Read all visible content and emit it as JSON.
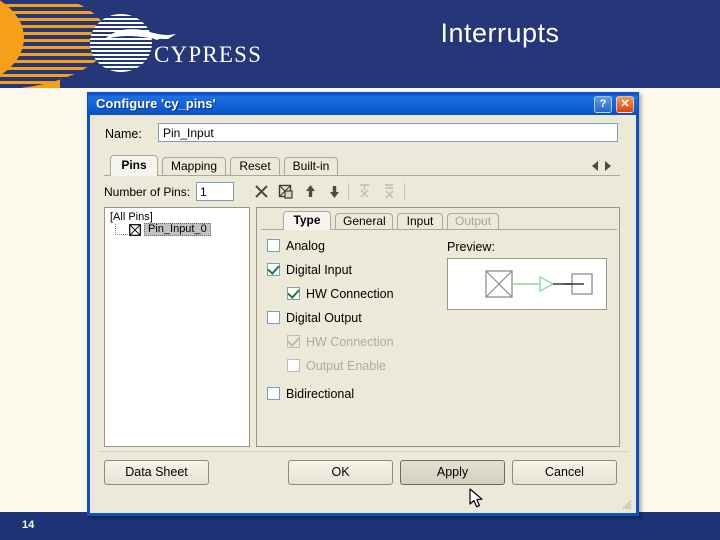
{
  "slide": {
    "title": "Interrupts",
    "number": "14",
    "brand": "CYPRESS",
    "colors": {
      "header_blue": "#253778",
      "accent_orange": "#f6a01a",
      "slide_bg": "#fdf8ec",
      "footer_blue": "#1d3476"
    }
  },
  "dialog": {
    "title": "Configure 'cy_pins'",
    "help_button": "?",
    "close_button": "✕",
    "name_label": "Name:",
    "name_value": "Pin_Input",
    "tabs": [
      {
        "label": "Pins",
        "active": true
      },
      {
        "label": "Mapping",
        "active": false
      },
      {
        "label": "Reset",
        "active": false
      },
      {
        "label": "Built-in",
        "active": false
      }
    ],
    "tab_nav": {
      "prev": "◀",
      "next": "▶"
    },
    "toolbar": {
      "pins_label": "Number of Pins:",
      "pins_value": "1",
      "icons": [
        {
          "name": "delete-pin-icon",
          "enabled": true
        },
        {
          "name": "edit-pin-icon",
          "enabled": true
        },
        {
          "name": "move-up-icon",
          "enabled": true
        },
        {
          "name": "move-down-icon",
          "enabled": true
        },
        {
          "name": "split-pin-icon",
          "enabled": false
        },
        {
          "name": "join-pin-icon",
          "enabled": false
        }
      ]
    },
    "tree": {
      "root": "[All Pins]",
      "items": [
        {
          "label": "Pin_Input_0",
          "selected": true
        }
      ]
    },
    "inner_tabs": [
      {
        "label": "Type",
        "active": true,
        "disabled": false
      },
      {
        "label": "General",
        "active": false,
        "disabled": false
      },
      {
        "label": "Input",
        "active": false,
        "disabled": false
      },
      {
        "label": "Output",
        "active": false,
        "disabled": true
      }
    ],
    "type_options": [
      {
        "label": "Analog",
        "checked": false,
        "disabled": false,
        "indent": 0
      },
      {
        "label": "Digital Input",
        "checked": true,
        "disabled": false,
        "indent": 0
      },
      {
        "label": "HW Connection",
        "checked": true,
        "disabled": false,
        "indent": 1
      },
      {
        "label": "Digital Output",
        "checked": false,
        "disabled": false,
        "indent": 0
      },
      {
        "label": "HW Connection",
        "checked": true,
        "disabled": true,
        "indent": 1
      },
      {
        "label": "Output Enable",
        "checked": false,
        "disabled": true,
        "indent": 1
      },
      {
        "label": "Bidirectional",
        "checked": false,
        "disabled": false,
        "indent": 0
      }
    ],
    "preview": {
      "label": "Preview:",
      "wire_color": "#8fd8a0"
    },
    "buttons": [
      {
        "label": "Data Sheet",
        "hover": false
      },
      {
        "label": "OK",
        "hover": false
      },
      {
        "label": "Apply",
        "hover": true
      },
      {
        "label": "Cancel",
        "hover": false
      }
    ]
  }
}
